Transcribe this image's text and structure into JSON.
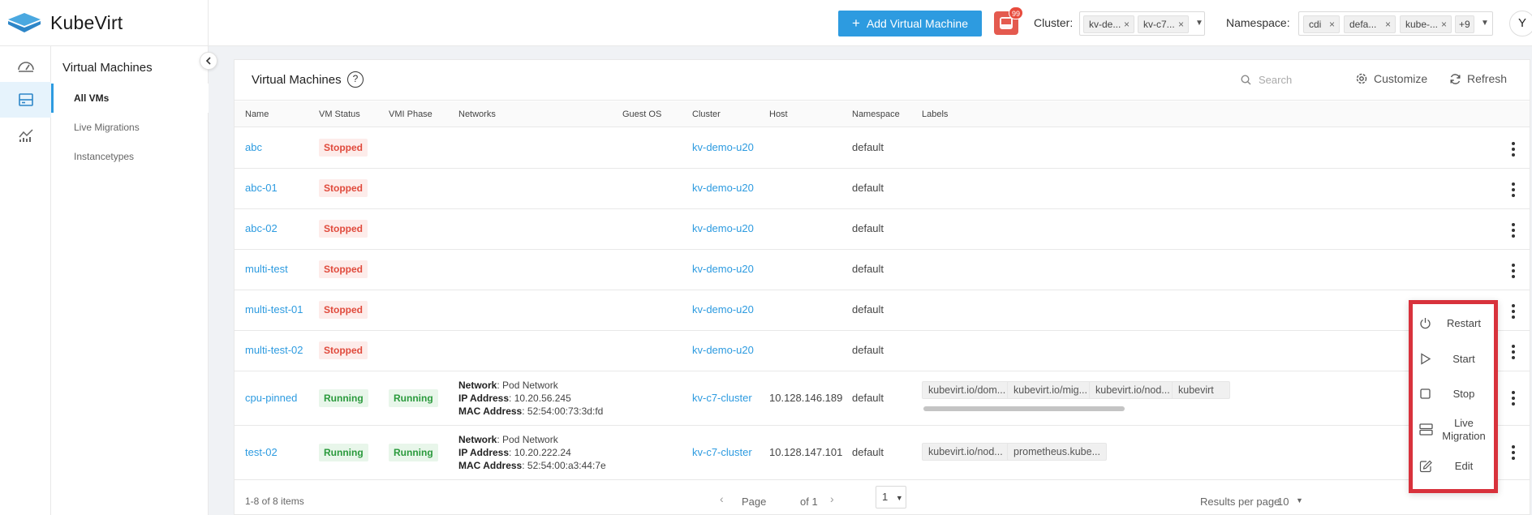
{
  "app": {
    "name": "KubeVirt"
  },
  "header": {
    "add_button": "Add Virtual Machine",
    "notification_count": "99",
    "cluster_label": "Cluster:",
    "cluster_tags": [
      "kv-de...",
      "kv-c7..."
    ],
    "namespace_label": "Namespace:",
    "namespace_tags": [
      "cdi",
      "defa...",
      "kube-..."
    ],
    "namespace_more": "+9",
    "avatar_initial": "Y"
  },
  "subnav": {
    "title": "Virtual Machines",
    "items": [
      {
        "label": "All VMs",
        "active": true
      },
      {
        "label": "Live Migrations",
        "active": false
      },
      {
        "label": "Instancetypes",
        "active": false
      }
    ]
  },
  "panel": {
    "title": "Virtual Machines",
    "help": "?",
    "search_placeholder": "Search",
    "customize": "Customize",
    "refresh": "Refresh"
  },
  "table": {
    "columns": [
      "Name",
      "VM Status",
      "VMI Phase",
      "Networks",
      "Guest OS",
      "Cluster",
      "Host",
      "Namespace",
      "Labels"
    ],
    "rows": [
      {
        "name": "abc",
        "vm_status": "Stopped",
        "vmi_phase": "",
        "cluster": "kv-demo-u20",
        "host": "",
        "namespace": "default",
        "labels": []
      },
      {
        "name": "abc-01",
        "vm_status": "Stopped",
        "vmi_phase": "",
        "cluster": "kv-demo-u20",
        "host": "",
        "namespace": "default",
        "labels": []
      },
      {
        "name": "abc-02",
        "vm_status": "Stopped",
        "vmi_phase": "",
        "cluster": "kv-demo-u20",
        "host": "",
        "namespace": "default",
        "labels": []
      },
      {
        "name": "multi-test",
        "vm_status": "Stopped",
        "vmi_phase": "",
        "cluster": "kv-demo-u20",
        "host": "",
        "namespace": "default",
        "labels": []
      },
      {
        "name": "multi-test-01",
        "vm_status": "Stopped",
        "vmi_phase": "",
        "cluster": "kv-demo-u20",
        "host": "",
        "namespace": "default",
        "labels": []
      },
      {
        "name": "multi-test-02",
        "vm_status": "Stopped",
        "vmi_phase": "",
        "cluster": "kv-demo-u20",
        "host": "",
        "namespace": "default",
        "labels": []
      },
      {
        "name": "cpu-pinned",
        "vm_status": "Running",
        "vmi_phase": "Running",
        "network": {
          "network_label": "Network",
          "network": "Pod Network",
          "ip_label": "IP Address",
          "ip": "10.20.56.245",
          "mac_label": "MAC Address",
          "mac": "52:54:00:73:3d:fd"
        },
        "cluster": "kv-c7-cluster",
        "host": "10.128.146.189",
        "namespace": "default",
        "labels": [
          "kubevirt.io/dom...",
          "kubevirt.io/mig...",
          "kubevirt.io/nod...",
          "kubevirt"
        ]
      },
      {
        "name": "test-02",
        "vm_status": "Running",
        "vmi_phase": "Running",
        "network": {
          "network_label": "Network",
          "network": "Pod Network",
          "ip_label": "IP Address",
          "ip": "10.20.222.24",
          "mac_label": "MAC Address",
          "mac": "52:54:00:a3:44:7e"
        },
        "cluster": "kv-c7-cluster",
        "host": "10.128.147.101",
        "namespace": "default",
        "labels": [
          "kubevirt.io/nod...",
          "prometheus.kube..."
        ]
      }
    ]
  },
  "action_menu": [
    {
      "label": "Restart",
      "icon": "power-icon"
    },
    {
      "label": "Start",
      "icon": "play-icon"
    },
    {
      "label": "Stop",
      "icon": "stop-icon"
    },
    {
      "label": "Live Migration",
      "icon": "server-icon"
    },
    {
      "label": "Edit",
      "icon": "edit-icon"
    }
  ],
  "footer": {
    "summary": "1-8 of 8 items",
    "page_label": "Page",
    "page_value": "1",
    "of_label": "of 1",
    "results_label": "Results per page",
    "results_value": "10"
  },
  "colors": {
    "accent": "#2d9be0",
    "stopped_text": "#e04a3c",
    "running_text": "#2a9a3c",
    "highlight_border": "#d8323c"
  }
}
